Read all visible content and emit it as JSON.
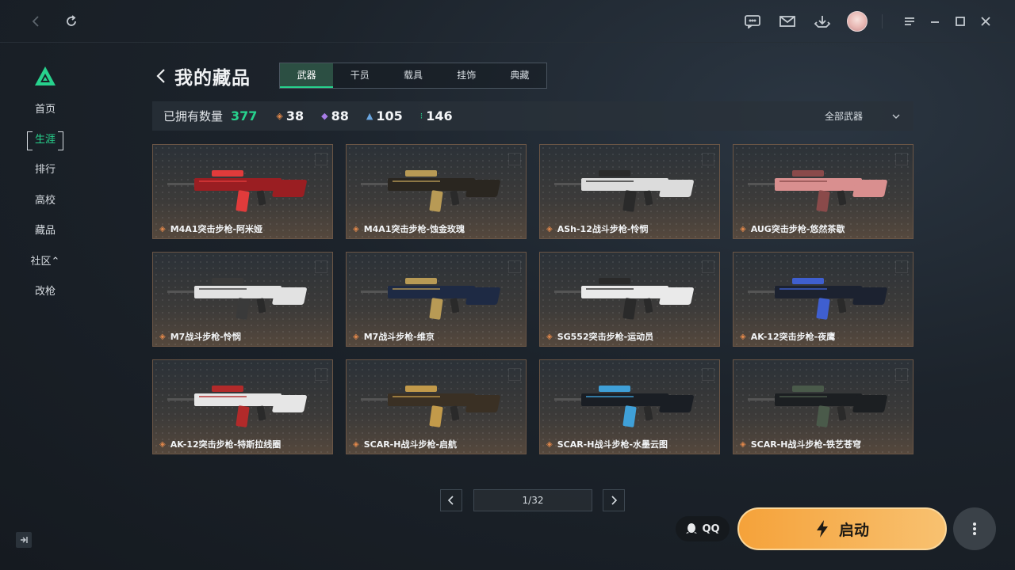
{
  "titlebar": {
    "icons": [
      "back-icon",
      "refresh-icon",
      "chat-icon",
      "mail-icon",
      "download-icon",
      "avatar",
      "menu-icon",
      "minimize-icon",
      "maximize-icon",
      "close-icon"
    ]
  },
  "sidebar": {
    "items": [
      {
        "label": "首页",
        "active": false
      },
      {
        "label": "生涯",
        "active": true
      },
      {
        "label": "排行",
        "active": false
      },
      {
        "label": "高校",
        "active": false
      },
      {
        "label": "藏品",
        "active": false
      },
      {
        "label": "社区⌃",
        "active": false
      },
      {
        "label": "改枪",
        "active": false
      }
    ]
  },
  "page": {
    "title": "我的藏品"
  },
  "tabs": [
    {
      "label": "武器",
      "active": true
    },
    {
      "label": "干员",
      "active": false
    },
    {
      "label": "载具",
      "active": false
    },
    {
      "label": "挂饰",
      "active": false
    },
    {
      "label": "典藏",
      "active": false
    }
  ],
  "stats": {
    "label": "已拥有数量",
    "total": "377",
    "items": [
      {
        "icon": "◈",
        "color": "#e0874a",
        "value": "38"
      },
      {
        "icon": "◆",
        "color": "#a77ce6",
        "value": "88"
      },
      {
        "icon": "▲",
        "color": "#6aa6e0",
        "value": "105"
      },
      {
        "icon": "⁝",
        "color": "#27d28d",
        "value": "146"
      }
    ],
    "filter": "全部武器"
  },
  "cards": [
    {
      "name": "M4A1突击步枪-阿米娅",
      "body": "#9a1e22",
      "accent": "#e13b3b"
    },
    {
      "name": "M4A1突击步枪-蚀金玫瑰",
      "body": "#2a2620",
      "accent": "#b89a55"
    },
    {
      "name": "ASh-12战斗步枪-怜悯",
      "body": "#dcdcdc",
      "accent": "#2a2a2a"
    },
    {
      "name": "AUG突击步枪-悠然茶歇",
      "body": "#d98f8f",
      "accent": "#8a4a4a"
    },
    {
      "name": "M7战斗步枪-怜悯",
      "body": "#e2e2e2",
      "accent": "#3a3a3a"
    },
    {
      "name": "M7战斗步枪-维京",
      "body": "#1e2a44",
      "accent": "#b89a55"
    },
    {
      "name": "SG552突击步枪-运动员",
      "body": "#eaeaea",
      "accent": "#2a2a2a"
    },
    {
      "name": "AK-12突击步枪-夜鹰",
      "body": "#1c2230",
      "accent": "#3f5fd0"
    },
    {
      "name": "AK-12突击步枪-特斯拉线圈",
      "body": "#e6e6e6",
      "accent": "#b22a2a"
    },
    {
      "name": "SCAR-H战斗步枪-启航",
      "body": "#3a3024",
      "accent": "#c29a4a"
    },
    {
      "name": "SCAR-H战斗步枪-水墨云图",
      "body": "#1a1e24",
      "accent": "#3fa0d8"
    },
    {
      "name": "SCAR-H战斗步枪-铁艺苍穹",
      "body": "#1c1f22",
      "accent": "#4a5a4a"
    }
  ],
  "pager": {
    "indicator": "1/32"
  },
  "footer": {
    "qq_label": "QQ",
    "launch_label": "启动"
  }
}
